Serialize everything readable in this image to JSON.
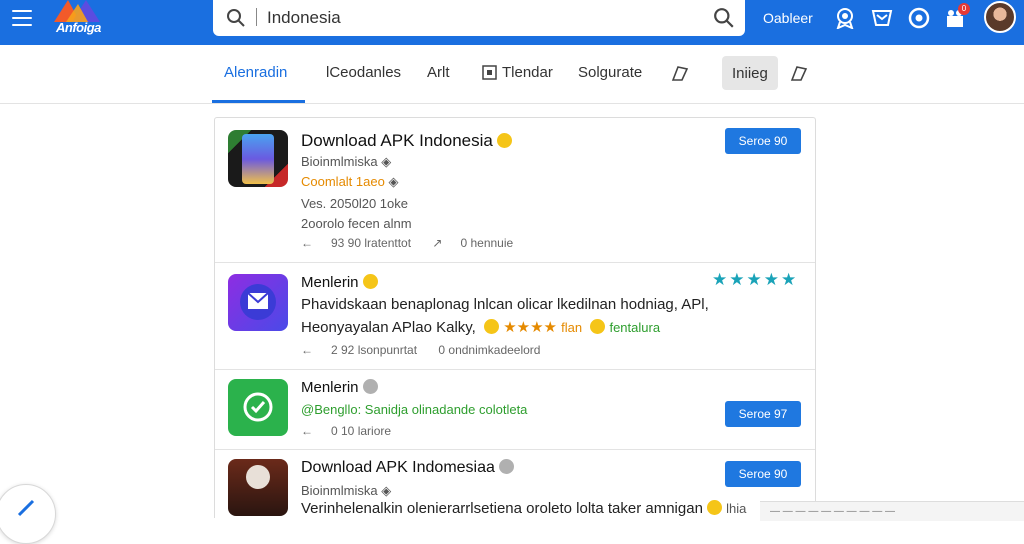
{
  "app": {
    "logo_text": "Anfoiga"
  },
  "search": {
    "value": "Indonesia",
    "placeholder": ""
  },
  "header": {
    "label": "Oableer"
  },
  "notifications": {
    "badge": "0"
  },
  "tabs": [
    {
      "label": "Alenradin",
      "active": true
    },
    {
      "label": "lCeodanles"
    },
    {
      "label": "Arlt"
    },
    {
      "label": "Tlendar"
    },
    {
      "label": "Solgurate"
    },
    {
      "label": "Iniieg"
    }
  ],
  "results": [
    {
      "title": "Download APK Indonesia",
      "sub": "Bioinmlmiska",
      "status": "Coomlalt  1aeo",
      "version": "Ves.  2050l20  1oke",
      "extra": "2oorolo fecen alnm",
      "meta": [
        "93 90  lratenttot",
        "0 hennuie"
      ],
      "button": "Seroe 90"
    },
    {
      "title": "Menlerin",
      "body1": "Phavidskaan benaplonag lnlcan olicar lkedilnan hodniag, APl,",
      "body2": "Heonyayalan APlao Kalky,",
      "body2_rating_label": "flan",
      "body2_tail": "fentalura",
      "meta": [
        "2  92  lsonpunrtat",
        "0 ondnimkadeelord"
      ],
      "star_count": 5
    },
    {
      "title": "Menlerin",
      "line": "@Bengllo:  Sanidja olinadande colotleta",
      "meta": [
        "0  10  lariore"
      ],
      "button": "Seroe 97"
    },
    {
      "title": "Download APK Indomesiaa",
      "sub": "Bioinmlmiska",
      "body1": "Verinhelenalkin olenierarrlsetiena oroleto lolta taker amnigan",
      "body1_tail": "lhia",
      "button": "Seroe 90"
    }
  ],
  "toast": {
    "text": "— — — — — — — — — —"
  },
  "colors": {
    "primary": "#1a6fe0",
    "button": "#1f78e0",
    "rating": "#1aa3b8",
    "status_orange": "#e58a00"
  },
  "icons": [
    "menu-icon",
    "search-icon",
    "award-icon",
    "inbox-icon",
    "help-icon",
    "gift-icon",
    "avatar",
    "tag-icon",
    "bookmark-icon"
  ]
}
